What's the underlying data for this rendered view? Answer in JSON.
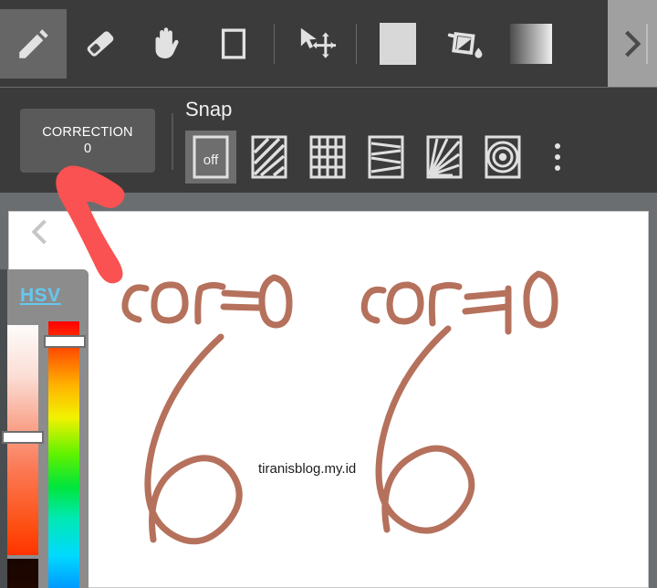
{
  "app": {
    "name": "drawing-app",
    "accent_color": "#66c8ee",
    "toolbar_bg": "#3b3b3b",
    "canvas_bg": "#6b6e70",
    "ink_color": "#b5715c",
    "annotation_color": "#fa5252"
  },
  "toolbar": {
    "tools": [
      {
        "name": "pencil-tool",
        "icon": "pencil-icon",
        "selected": true
      },
      {
        "name": "eraser-tool",
        "icon": "eraser-icon",
        "selected": false
      },
      {
        "name": "hand-tool",
        "icon": "hand-icon",
        "selected": false
      },
      {
        "name": "rectangle-tool",
        "icon": "rectangle-icon",
        "selected": false
      },
      {
        "name": "select-move-tool",
        "icon": "select-move-icon",
        "selected": false
      },
      {
        "name": "color-swatch-tool",
        "icon": "filled-square-icon",
        "selected": false
      },
      {
        "name": "paint-bucket-tool",
        "icon": "paint-bucket-icon",
        "selected": false
      },
      {
        "name": "gradient-tool",
        "icon": "gradient-icon",
        "selected": false
      }
    ],
    "scroll_next": {
      "label": "scroll-right",
      "icon": "chevron-right-icon"
    }
  },
  "options": {
    "correction": {
      "label": "CORRECTION",
      "value": "0"
    },
    "snap": {
      "label": "Snap",
      "items": [
        {
          "name": "snap-off",
          "label": "off",
          "icon": "snap-off-icon",
          "selected": true
        },
        {
          "name": "snap-diagonal",
          "label": "",
          "icon": "diagonal-lines-icon",
          "selected": false
        },
        {
          "name": "snap-grid",
          "label": "",
          "icon": "grid-icon",
          "selected": false
        },
        {
          "name": "snap-perspective",
          "label": "",
          "icon": "perspective-icon",
          "selected": false
        },
        {
          "name": "snap-radial",
          "label": "",
          "icon": "radial-rays-icon",
          "selected": false
        },
        {
          "name": "snap-concentric",
          "label": "",
          "icon": "concentric-circles-icon",
          "selected": false
        }
      ],
      "overflow": {
        "name": "snap-more-menu",
        "icon": "three-dots-icon"
      }
    }
  },
  "canvas": {
    "collapse_toggle": {
      "name": "collapse-panel",
      "icon": "chevron-left-icon"
    },
    "watermark": "tiranisblog.my.id",
    "annotations": [
      {
        "name": "handwriting-left",
        "text": "cor=0"
      },
      {
        "name": "handwriting-right",
        "text": "cor =10"
      }
    ],
    "drawings": [
      {
        "name": "digit-six-left",
        "text": "6"
      },
      {
        "name": "digit-six-right",
        "text": "6"
      }
    ]
  },
  "color_panel": {
    "title": "HSV",
    "sliders": [
      {
        "name": "saturation-value-slider",
        "handle_position_pct": 46
      },
      {
        "name": "hue-slider",
        "handle_position_pct": 5
      }
    ]
  }
}
